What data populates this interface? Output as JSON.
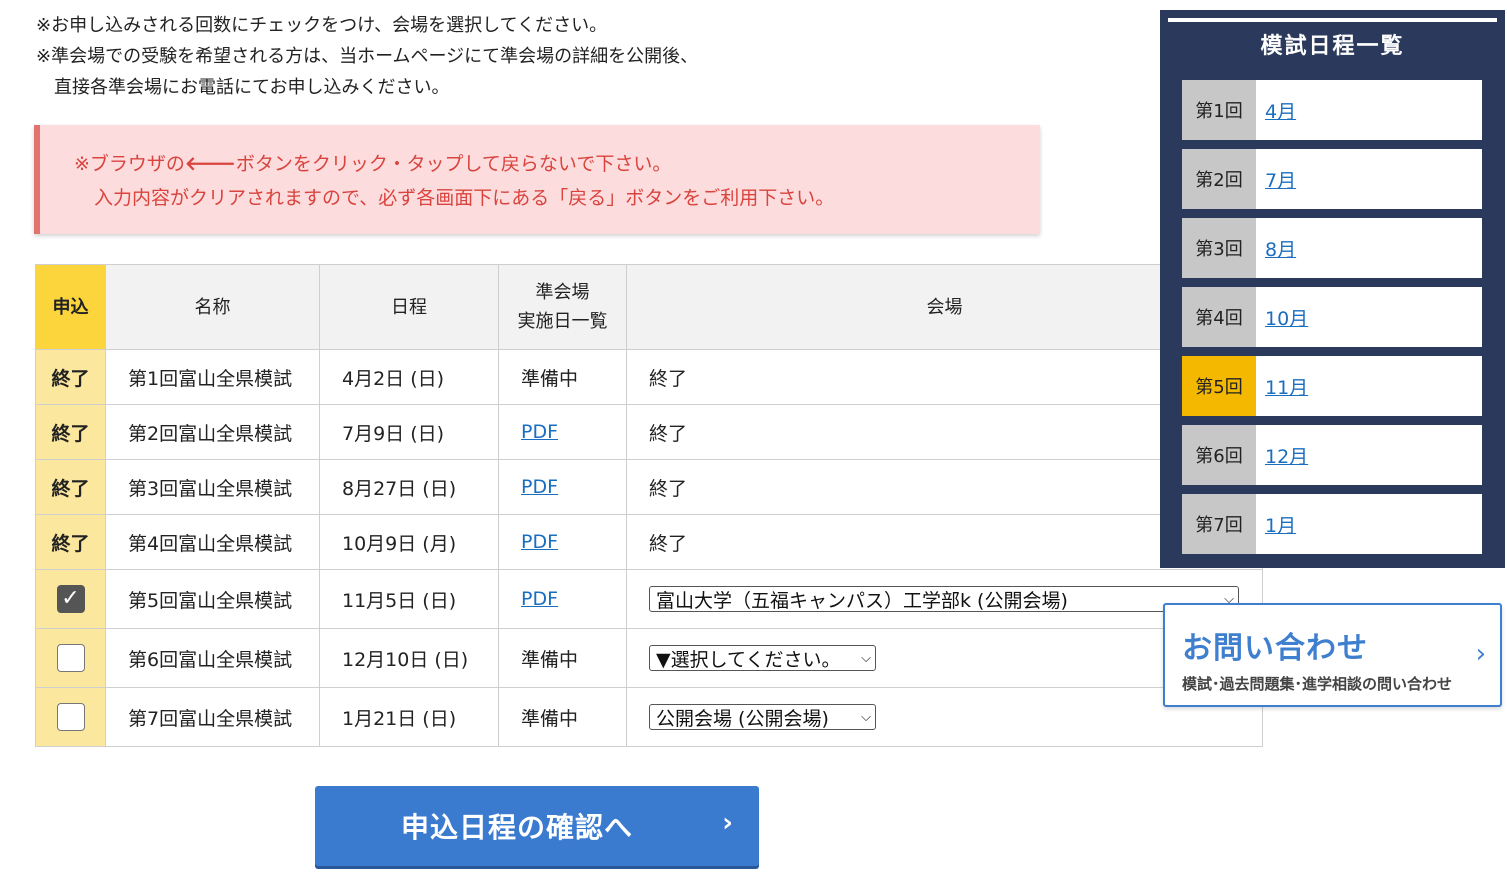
{
  "notes": {
    "line1": "※お申し込みされる回数にチェックをつけ、会場を選択してください。",
    "line2": "※準会場での受験を希望される方は、当ホームページにて準会場の詳細を公開後、",
    "line3": "直接各準会場にお電話にてお申し込みください。"
  },
  "alert": {
    "prefix": "※ブラウザの",
    "arrow": "🡐",
    "suffix": "ボタンをクリック・タップして戻らないで下さい。",
    "line2": "入力内容がクリアされますので、必ず各画面下にある「戻る」ボタンをご利用下さい。"
  },
  "table": {
    "headers": {
      "apply": "申込",
      "name": "名称",
      "date": "日程",
      "pre_line1": "準会場",
      "pre_line2": "実施日一覧",
      "venue": "会場"
    },
    "rows": [
      {
        "status": "終了",
        "name": "第1回富山全県模試",
        "date": "4月2日 (日)",
        "pre": "準備中",
        "venue": "終了"
      },
      {
        "status": "終了",
        "name": "第2回富山全県模試",
        "date": "7月9日 (日)",
        "pre": "PDF",
        "venue": "終了"
      },
      {
        "status": "終了",
        "name": "第3回富山全県模試",
        "date": "8月27日 (日)",
        "pre": "PDF",
        "venue": "終了"
      },
      {
        "status": "終了",
        "name": "第4回富山全県模試",
        "date": "10月9日 (月)",
        "pre": "PDF",
        "venue": "終了"
      },
      {
        "checked": true,
        "name": "第5回富山全県模試",
        "date": "11月5日 (日)",
        "pre": "PDF",
        "venue_select": "富山大学（五福キャンパス）工学部k (公開会場)"
      },
      {
        "checked": false,
        "name": "第6回富山全県模試",
        "date": "12月10日 (日)",
        "pre": "準備中",
        "venue_select": "▼選択してください。"
      },
      {
        "checked": false,
        "name": "第7回富山全県模試",
        "date": "1月21日 (日)",
        "pre": "準備中",
        "venue_select": "公開会場 (公開会場)"
      }
    ]
  },
  "sidebar": {
    "title": "模試日程一覧",
    "items": [
      {
        "num": "第1回",
        "month": "4月"
      },
      {
        "num": "第2回",
        "month": "7月"
      },
      {
        "num": "第3回",
        "month": "8月"
      },
      {
        "num": "第4回",
        "month": "10月"
      },
      {
        "num": "第5回",
        "month": "11月",
        "current": true
      },
      {
        "num": "第6回",
        "month": "12月"
      },
      {
        "num": "第7回",
        "month": "1月"
      }
    ]
  },
  "contact": {
    "title": "お問い合わせ",
    "subtitle": "模試･過去問題集･進学相談の問い合わせ"
  },
  "confirm_button": {
    "label": "申込日程の確認へ"
  },
  "colors": {
    "sidebar_bg": "#2b3a5c",
    "current_highlight": "#f5b800",
    "apply_header": "#fcd43c",
    "apply_cell": "#fbe79d",
    "alert_bg": "#fddcdd",
    "alert_text": "#d9443e",
    "primary_button": "#3a7bcf",
    "link": "#1a6ec0"
  }
}
